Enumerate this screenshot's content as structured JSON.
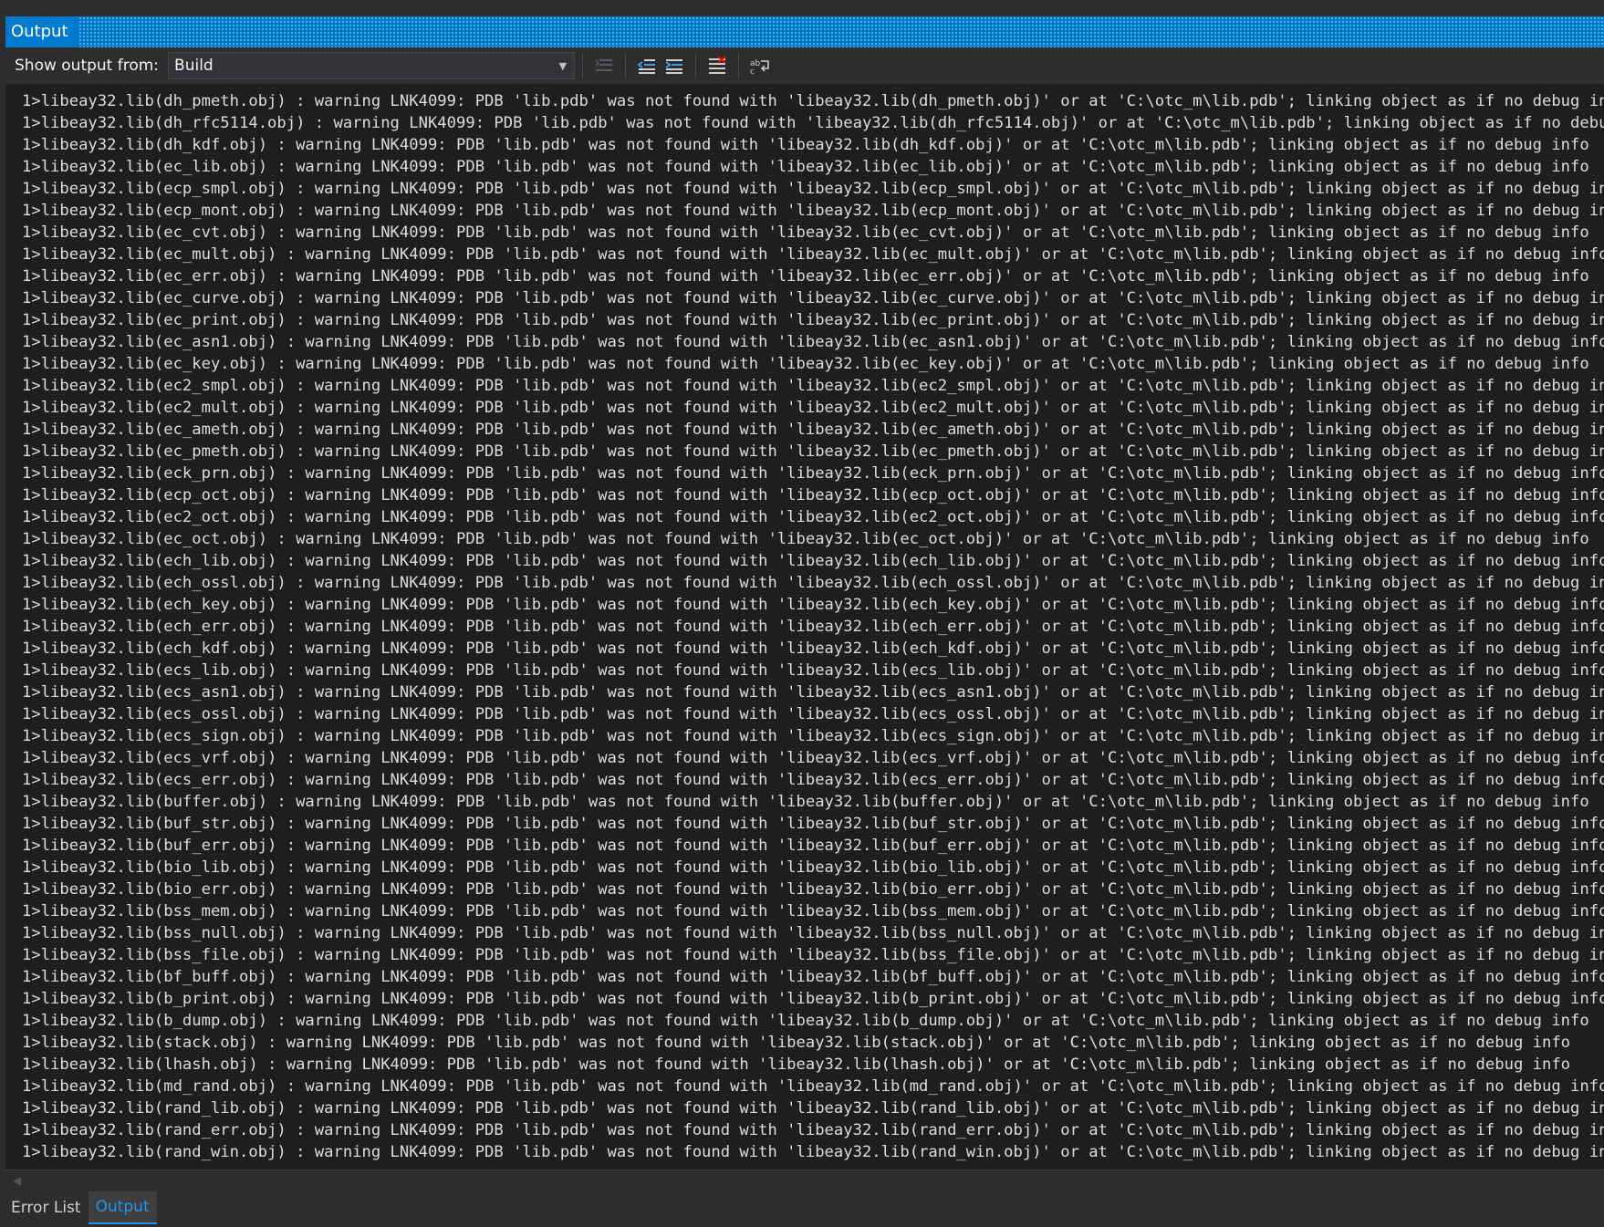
{
  "window": {
    "title": "Output"
  },
  "toolbar": {
    "show_output_label": "Show output from:",
    "source_value": "Build",
    "icons": [
      "find-message-in-code-icon",
      "go-to-previous-message-icon",
      "go-to-next-message-icon",
      "clear-all-icon",
      "toggle-word-wrap-icon"
    ]
  },
  "log": {
    "lines": [
      "1>libeay32.lib(dh_pmeth.obj) : warning LNK4099: PDB 'lib.pdb' was not found with 'libeay32.lib(dh_pmeth.obj)' or at 'C:\\otc_m\\lib.pdb'; linking object as if no debug info",
      "1>libeay32.lib(dh_rfc5114.obj) : warning LNK4099: PDB 'lib.pdb' was not found with 'libeay32.lib(dh_rfc5114.obj)' or at 'C:\\otc_m\\lib.pdb'; linking object as if no debug info",
      "1>libeay32.lib(dh_kdf.obj) : warning LNK4099: PDB 'lib.pdb' was not found with 'libeay32.lib(dh_kdf.obj)' or at 'C:\\otc_m\\lib.pdb'; linking object as if no debug info",
      "1>libeay32.lib(ec_lib.obj) : warning LNK4099: PDB 'lib.pdb' was not found with 'libeay32.lib(ec_lib.obj)' or at 'C:\\otc_m\\lib.pdb'; linking object as if no debug info",
      "1>libeay32.lib(ecp_smpl.obj) : warning LNK4099: PDB 'lib.pdb' was not found with 'libeay32.lib(ecp_smpl.obj)' or at 'C:\\otc_m\\lib.pdb'; linking object as if no debug info",
      "1>libeay32.lib(ecp_mont.obj) : warning LNK4099: PDB 'lib.pdb' was not found with 'libeay32.lib(ecp_mont.obj)' or at 'C:\\otc_m\\lib.pdb'; linking object as if no debug info",
      "1>libeay32.lib(ec_cvt.obj) : warning LNK4099: PDB 'lib.pdb' was not found with 'libeay32.lib(ec_cvt.obj)' or at 'C:\\otc_m\\lib.pdb'; linking object as if no debug info",
      "1>libeay32.lib(ec_mult.obj) : warning LNK4099: PDB 'lib.pdb' was not found with 'libeay32.lib(ec_mult.obj)' or at 'C:\\otc_m\\lib.pdb'; linking object as if no debug info",
      "1>libeay32.lib(ec_err.obj) : warning LNK4099: PDB 'lib.pdb' was not found with 'libeay32.lib(ec_err.obj)' or at 'C:\\otc_m\\lib.pdb'; linking object as if no debug info",
      "1>libeay32.lib(ec_curve.obj) : warning LNK4099: PDB 'lib.pdb' was not found with 'libeay32.lib(ec_curve.obj)' or at 'C:\\otc_m\\lib.pdb'; linking object as if no debug info",
      "1>libeay32.lib(ec_print.obj) : warning LNK4099: PDB 'lib.pdb' was not found with 'libeay32.lib(ec_print.obj)' or at 'C:\\otc_m\\lib.pdb'; linking object as if no debug info",
      "1>libeay32.lib(ec_asn1.obj) : warning LNK4099: PDB 'lib.pdb' was not found with 'libeay32.lib(ec_asn1.obj)' or at 'C:\\otc_m\\lib.pdb'; linking object as if no debug info",
      "1>libeay32.lib(ec_key.obj) : warning LNK4099: PDB 'lib.pdb' was not found with 'libeay32.lib(ec_key.obj)' or at 'C:\\otc_m\\lib.pdb'; linking object as if no debug info",
      "1>libeay32.lib(ec2_smpl.obj) : warning LNK4099: PDB 'lib.pdb' was not found with 'libeay32.lib(ec2_smpl.obj)' or at 'C:\\otc_m\\lib.pdb'; linking object as if no debug info",
      "1>libeay32.lib(ec2_mult.obj) : warning LNK4099: PDB 'lib.pdb' was not found with 'libeay32.lib(ec2_mult.obj)' or at 'C:\\otc_m\\lib.pdb'; linking object as if no debug info",
      "1>libeay32.lib(ec_ameth.obj) : warning LNK4099: PDB 'lib.pdb' was not found with 'libeay32.lib(ec_ameth.obj)' or at 'C:\\otc_m\\lib.pdb'; linking object as if no debug info",
      "1>libeay32.lib(ec_pmeth.obj) : warning LNK4099: PDB 'lib.pdb' was not found with 'libeay32.lib(ec_pmeth.obj)' or at 'C:\\otc_m\\lib.pdb'; linking object as if no debug info",
      "1>libeay32.lib(eck_prn.obj) : warning LNK4099: PDB 'lib.pdb' was not found with 'libeay32.lib(eck_prn.obj)' or at 'C:\\otc_m\\lib.pdb'; linking object as if no debug info",
      "1>libeay32.lib(ecp_oct.obj) : warning LNK4099: PDB 'lib.pdb' was not found with 'libeay32.lib(ecp_oct.obj)' or at 'C:\\otc_m\\lib.pdb'; linking object as if no debug info",
      "1>libeay32.lib(ec2_oct.obj) : warning LNK4099: PDB 'lib.pdb' was not found with 'libeay32.lib(ec2_oct.obj)' or at 'C:\\otc_m\\lib.pdb'; linking object as if no debug info",
      "1>libeay32.lib(ec_oct.obj) : warning LNK4099: PDB 'lib.pdb' was not found with 'libeay32.lib(ec_oct.obj)' or at 'C:\\otc_m\\lib.pdb'; linking object as if no debug info",
      "1>libeay32.lib(ech_lib.obj) : warning LNK4099: PDB 'lib.pdb' was not found with 'libeay32.lib(ech_lib.obj)' or at 'C:\\otc_m\\lib.pdb'; linking object as if no debug info",
      "1>libeay32.lib(ech_ossl.obj) : warning LNK4099: PDB 'lib.pdb' was not found with 'libeay32.lib(ech_ossl.obj)' or at 'C:\\otc_m\\lib.pdb'; linking object as if no debug info",
      "1>libeay32.lib(ech_key.obj) : warning LNK4099: PDB 'lib.pdb' was not found with 'libeay32.lib(ech_key.obj)' or at 'C:\\otc_m\\lib.pdb'; linking object as if no debug info",
      "1>libeay32.lib(ech_err.obj) : warning LNK4099: PDB 'lib.pdb' was not found with 'libeay32.lib(ech_err.obj)' or at 'C:\\otc_m\\lib.pdb'; linking object as if no debug info",
      "1>libeay32.lib(ech_kdf.obj) : warning LNK4099: PDB 'lib.pdb' was not found with 'libeay32.lib(ech_kdf.obj)' or at 'C:\\otc_m\\lib.pdb'; linking object as if no debug info",
      "1>libeay32.lib(ecs_lib.obj) : warning LNK4099: PDB 'lib.pdb' was not found with 'libeay32.lib(ecs_lib.obj)' or at 'C:\\otc_m\\lib.pdb'; linking object as if no debug info",
      "1>libeay32.lib(ecs_asn1.obj) : warning LNK4099: PDB 'lib.pdb' was not found with 'libeay32.lib(ecs_asn1.obj)' or at 'C:\\otc_m\\lib.pdb'; linking object as if no debug info",
      "1>libeay32.lib(ecs_ossl.obj) : warning LNK4099: PDB 'lib.pdb' was not found with 'libeay32.lib(ecs_ossl.obj)' or at 'C:\\otc_m\\lib.pdb'; linking object as if no debug info",
      "1>libeay32.lib(ecs_sign.obj) : warning LNK4099: PDB 'lib.pdb' was not found with 'libeay32.lib(ecs_sign.obj)' or at 'C:\\otc_m\\lib.pdb'; linking object as if no debug info",
      "1>libeay32.lib(ecs_vrf.obj) : warning LNK4099: PDB 'lib.pdb' was not found with 'libeay32.lib(ecs_vrf.obj)' or at 'C:\\otc_m\\lib.pdb'; linking object as if no debug info",
      "1>libeay32.lib(ecs_err.obj) : warning LNK4099: PDB 'lib.pdb' was not found with 'libeay32.lib(ecs_err.obj)' or at 'C:\\otc_m\\lib.pdb'; linking object as if no debug info",
      "1>libeay32.lib(buffer.obj) : warning LNK4099: PDB 'lib.pdb' was not found with 'libeay32.lib(buffer.obj)' or at 'C:\\otc_m\\lib.pdb'; linking object as if no debug info",
      "1>libeay32.lib(buf_str.obj) : warning LNK4099: PDB 'lib.pdb' was not found with 'libeay32.lib(buf_str.obj)' or at 'C:\\otc_m\\lib.pdb'; linking object as if no debug info",
      "1>libeay32.lib(buf_err.obj) : warning LNK4099: PDB 'lib.pdb' was not found with 'libeay32.lib(buf_err.obj)' or at 'C:\\otc_m\\lib.pdb'; linking object as if no debug info",
      "1>libeay32.lib(bio_lib.obj) : warning LNK4099: PDB 'lib.pdb' was not found with 'libeay32.lib(bio_lib.obj)' or at 'C:\\otc_m\\lib.pdb'; linking object as if no debug info",
      "1>libeay32.lib(bio_err.obj) : warning LNK4099: PDB 'lib.pdb' was not found with 'libeay32.lib(bio_err.obj)' or at 'C:\\otc_m\\lib.pdb'; linking object as if no debug info",
      "1>libeay32.lib(bss_mem.obj) : warning LNK4099: PDB 'lib.pdb' was not found with 'libeay32.lib(bss_mem.obj)' or at 'C:\\otc_m\\lib.pdb'; linking object as if no debug info",
      "1>libeay32.lib(bss_null.obj) : warning LNK4099: PDB 'lib.pdb' was not found with 'libeay32.lib(bss_null.obj)' or at 'C:\\otc_m\\lib.pdb'; linking object as if no debug info",
      "1>libeay32.lib(bss_file.obj) : warning LNK4099: PDB 'lib.pdb' was not found with 'libeay32.lib(bss_file.obj)' or at 'C:\\otc_m\\lib.pdb'; linking object as if no debug info",
      "1>libeay32.lib(bf_buff.obj) : warning LNK4099: PDB 'lib.pdb' was not found with 'libeay32.lib(bf_buff.obj)' or at 'C:\\otc_m\\lib.pdb'; linking object as if no debug info",
      "1>libeay32.lib(b_print.obj) : warning LNK4099: PDB 'lib.pdb' was not found with 'libeay32.lib(b_print.obj)' or at 'C:\\otc_m\\lib.pdb'; linking object as if no debug info",
      "1>libeay32.lib(b_dump.obj) : warning LNK4099: PDB 'lib.pdb' was not found with 'libeay32.lib(b_dump.obj)' or at 'C:\\otc_m\\lib.pdb'; linking object as if no debug info",
      "1>libeay32.lib(stack.obj) : warning LNK4099: PDB 'lib.pdb' was not found with 'libeay32.lib(stack.obj)' or at 'C:\\otc_m\\lib.pdb'; linking object as if no debug info",
      "1>libeay32.lib(lhash.obj) : warning LNK4099: PDB 'lib.pdb' was not found with 'libeay32.lib(lhash.obj)' or at 'C:\\otc_m\\lib.pdb'; linking object as if no debug info",
      "1>libeay32.lib(md_rand.obj) : warning LNK4099: PDB 'lib.pdb' was not found with 'libeay32.lib(md_rand.obj)' or at 'C:\\otc_m\\lib.pdb'; linking object as if no debug info",
      "1>libeay32.lib(rand_lib.obj) : warning LNK4099: PDB 'lib.pdb' was not found with 'libeay32.lib(rand_lib.obj)' or at 'C:\\otc_m\\lib.pdb'; linking object as if no debug info",
      "1>libeay32.lib(rand_err.obj) : warning LNK4099: PDB 'lib.pdb' was not found with 'libeay32.lib(rand_err.obj)' or at 'C:\\otc_m\\lib.pdb'; linking object as if no debug info",
      "1>libeay32.lib(rand_win.obj) : warning LNK4099: PDB 'lib.pdb' was not found with 'libeay32.lib(rand_win.obj)' or at 'C:\\otc_m\\lib.pdb'; linking object as if no debug info"
    ]
  },
  "bottom_tabs": [
    {
      "label": "Error List",
      "active": false
    },
    {
      "label": "Output",
      "active": true
    }
  ],
  "colors": {
    "accent": "#007acc",
    "active_tab_text": "#1c97ea",
    "log_background": "#1e1e1e",
    "log_text": "#dcdcdc"
  }
}
